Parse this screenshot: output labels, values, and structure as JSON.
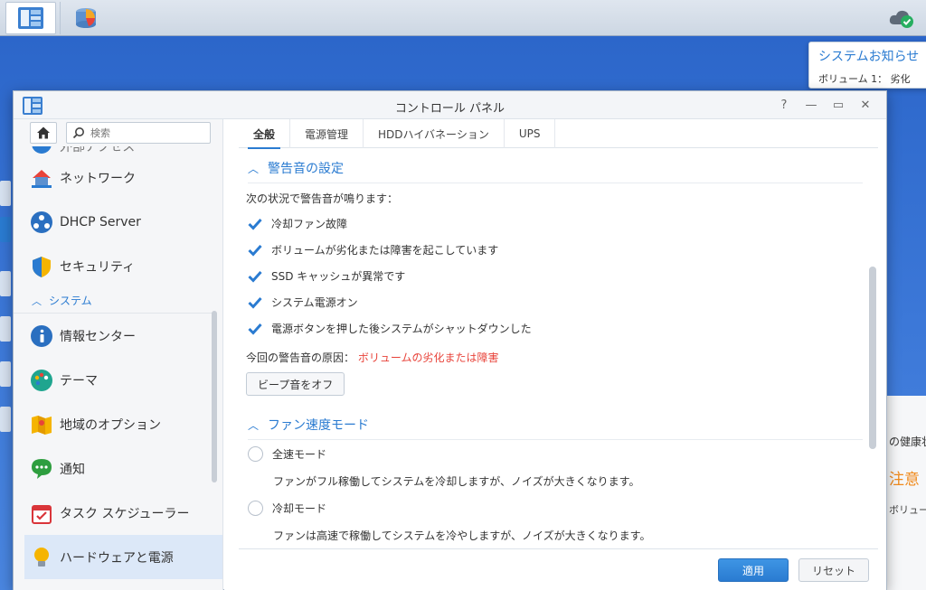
{
  "window": {
    "title": "コントロール パネル",
    "help": "?",
    "minimize": "—",
    "maximize": "▭",
    "close": "✕"
  },
  "notification": {
    "title": "システムお知らせ",
    "body": "ボリューム 1： 劣化"
  },
  "widget": {
    "line1": "の健康状態",
    "line2": "注意",
    "line3": "ボリュー"
  },
  "sidebar": {
    "search_placeholder": "検索",
    "partial_top": "外部アクセス",
    "items": [
      {
        "label": "ネットワーク",
        "icon": "network-icon"
      },
      {
        "label": "DHCP Server",
        "icon": "dhcp-icon"
      },
      {
        "label": "セキュリティ",
        "icon": "shield-icon"
      }
    ],
    "section": "システム",
    "system_items": [
      {
        "label": "情報センター",
        "icon": "info-icon"
      },
      {
        "label": "テーマ",
        "icon": "palette-icon"
      },
      {
        "label": "地域のオプション",
        "icon": "region-icon"
      },
      {
        "label": "通知",
        "icon": "chat-icon"
      },
      {
        "label": "タスク スケジューラー",
        "icon": "calendar-icon"
      },
      {
        "label": "ハードウェアと電源",
        "icon": "bulb-icon"
      }
    ]
  },
  "tabs": [
    "全般",
    "電源管理",
    "HDDハイバネーション",
    "UPS"
  ],
  "beep": {
    "header": "警告音の設定",
    "intro": "次の状況で警告音が鳴ります：",
    "options": [
      "冷却ファン故障",
      "ボリュームが劣化または障害を起こしています",
      "SSD キャッシュが異常です",
      "システム電源オン",
      "電源ボタンを押した後システムがシャットダウンした"
    ],
    "cause_label": "今回の警告音の原因：",
    "cause_value": "ボリュームの劣化または障害",
    "beep_off_button": "ビープ音をオフ"
  },
  "fan": {
    "header": "ファン速度モード",
    "modes": [
      {
        "label": "全速モード",
        "desc": "ファンがフル稼働してシステムを冷却しますが、ノイズが大きくなります。"
      },
      {
        "label": "冷却モード",
        "desc": "ファンは高速で稼働してシステムを冷やしますが、ノイズが大きくなります。"
      }
    ]
  },
  "footer": {
    "apply": "適用",
    "reset": "リセット"
  },
  "colors": {
    "accent": "#2a7bd1",
    "warning_text": "#e8433a",
    "desktop": "#3c78d8"
  }
}
